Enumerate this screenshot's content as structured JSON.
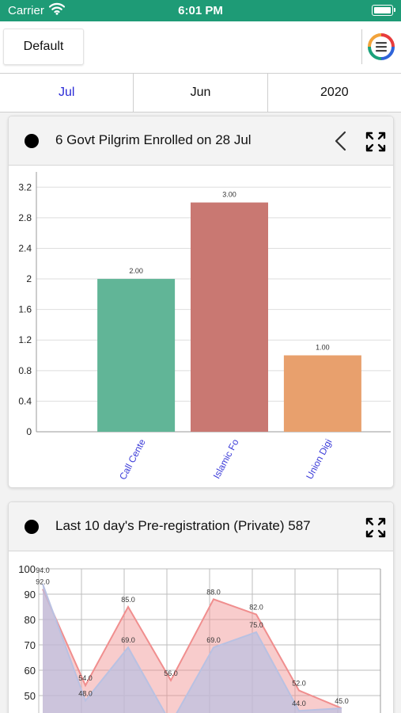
{
  "status_bar": {
    "carrier": "Carrier",
    "time": "6:01 PM"
  },
  "toolbar": {
    "default_label": "Default",
    "menu_icon": "menu-logo-icon"
  },
  "tabs": [
    {
      "label": "Jul",
      "active": true
    },
    {
      "label": "Jun",
      "active": false
    },
    {
      "label": "2020",
      "active": false
    }
  ],
  "cards": [
    {
      "title": "6 Govt Pilgrim Enrolled on 28 Jul",
      "icons": [
        "back-icon",
        "expand-icon"
      ]
    },
    {
      "title": "Last 10 day's Pre-registration (Private) 587",
      "icons": [
        "expand-icon"
      ]
    }
  ],
  "colors": {
    "status_bar": "#1e9b76",
    "active_tab": "#2a2ad6",
    "bar_colors": [
      "#61b597",
      "#c97872",
      "#e8a06d"
    ],
    "axis_label_color": "#3a3ad8",
    "area_series_1": "#f08e8e",
    "area_series_2": "#b9c1e2"
  },
  "chart_data": [
    {
      "type": "bar",
      "categories": [
        "Call Cente",
        "Islamic Fo",
        "Union Digi"
      ],
      "values": [
        2.0,
        3.0,
        1.0
      ],
      "value_labels": [
        "2.00",
        "3.00",
        "1.00"
      ],
      "ylim": [
        0,
        3.4
      ],
      "yticks": [
        "0",
        "0.4",
        "0.8",
        "1.2",
        "1.6",
        "2",
        "2.4",
        "2.8",
        "3.2"
      ],
      "grid": true
    },
    {
      "type": "area",
      "ylim": [
        45,
        100
      ],
      "yticks": [
        "50",
        "60",
        "70",
        "80",
        "90",
        "100"
      ],
      "grid": true,
      "series": [
        {
          "values": [
            92.0,
            54.0,
            85.0,
            56.0,
            88.0,
            82.0,
            52.0,
            45.0
          ],
          "labels": [
            "92.0",
            "54.0",
            "85.0",
            "56.0",
            "88.0",
            "82.0",
            "52.0",
            ""
          ]
        },
        {
          "values": [
            94.0,
            48.0,
            69.0,
            39.0,
            69.0,
            75.0,
            44.0,
            45.0
          ],
          "labels": [
            "94.0",
            "48.0",
            "69.0",
            "",
            "69.0",
            "75.0",
            "44.0",
            "45.0"
          ]
        }
      ]
    }
  ]
}
